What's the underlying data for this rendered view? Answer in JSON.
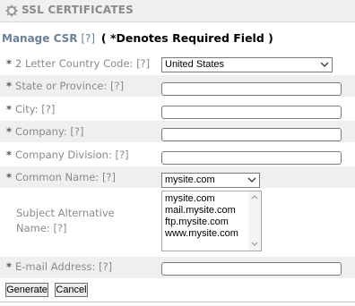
{
  "header": {
    "title": "SSL CERTIFICATES"
  },
  "subheader": {
    "manage": "Manage CSR",
    "help": "[?]",
    "required_note": "( *Denotes Required Field )"
  },
  "fields": {
    "country": {
      "star": "*",
      "label": "2 Letter Country Code:",
      "help": "[?]",
      "value": "United States"
    },
    "state": {
      "star": "*",
      "label": "State or Province:",
      "help": "[?]",
      "value": ""
    },
    "city": {
      "star": "*",
      "label": "City:",
      "help": "[?]",
      "value": ""
    },
    "company": {
      "star": "*",
      "label": "Company:",
      "help": "[?]",
      "value": ""
    },
    "division": {
      "star": "*",
      "label": "Company Division:",
      "help": "[?]",
      "value": ""
    },
    "common_name": {
      "star": "*",
      "label": "Common Name:",
      "help": "[?]",
      "value": "mysite.com"
    },
    "san": {
      "label_line1": "Subject Alternative",
      "label_line2": "Name:",
      "help": "[?]",
      "options": [
        "mysite.com",
        "mail.mysite.com",
        "ftp.mysite.com",
        "www.mysite.com"
      ]
    },
    "email": {
      "star": "*",
      "label": "E-mail Address:",
      "help": "[?]",
      "value": ""
    }
  },
  "buttons": {
    "generate": "Generate",
    "cancel": "Cancel"
  },
  "icons": {
    "title": "gear-icon",
    "dropdown": "chevron-down-icon"
  }
}
